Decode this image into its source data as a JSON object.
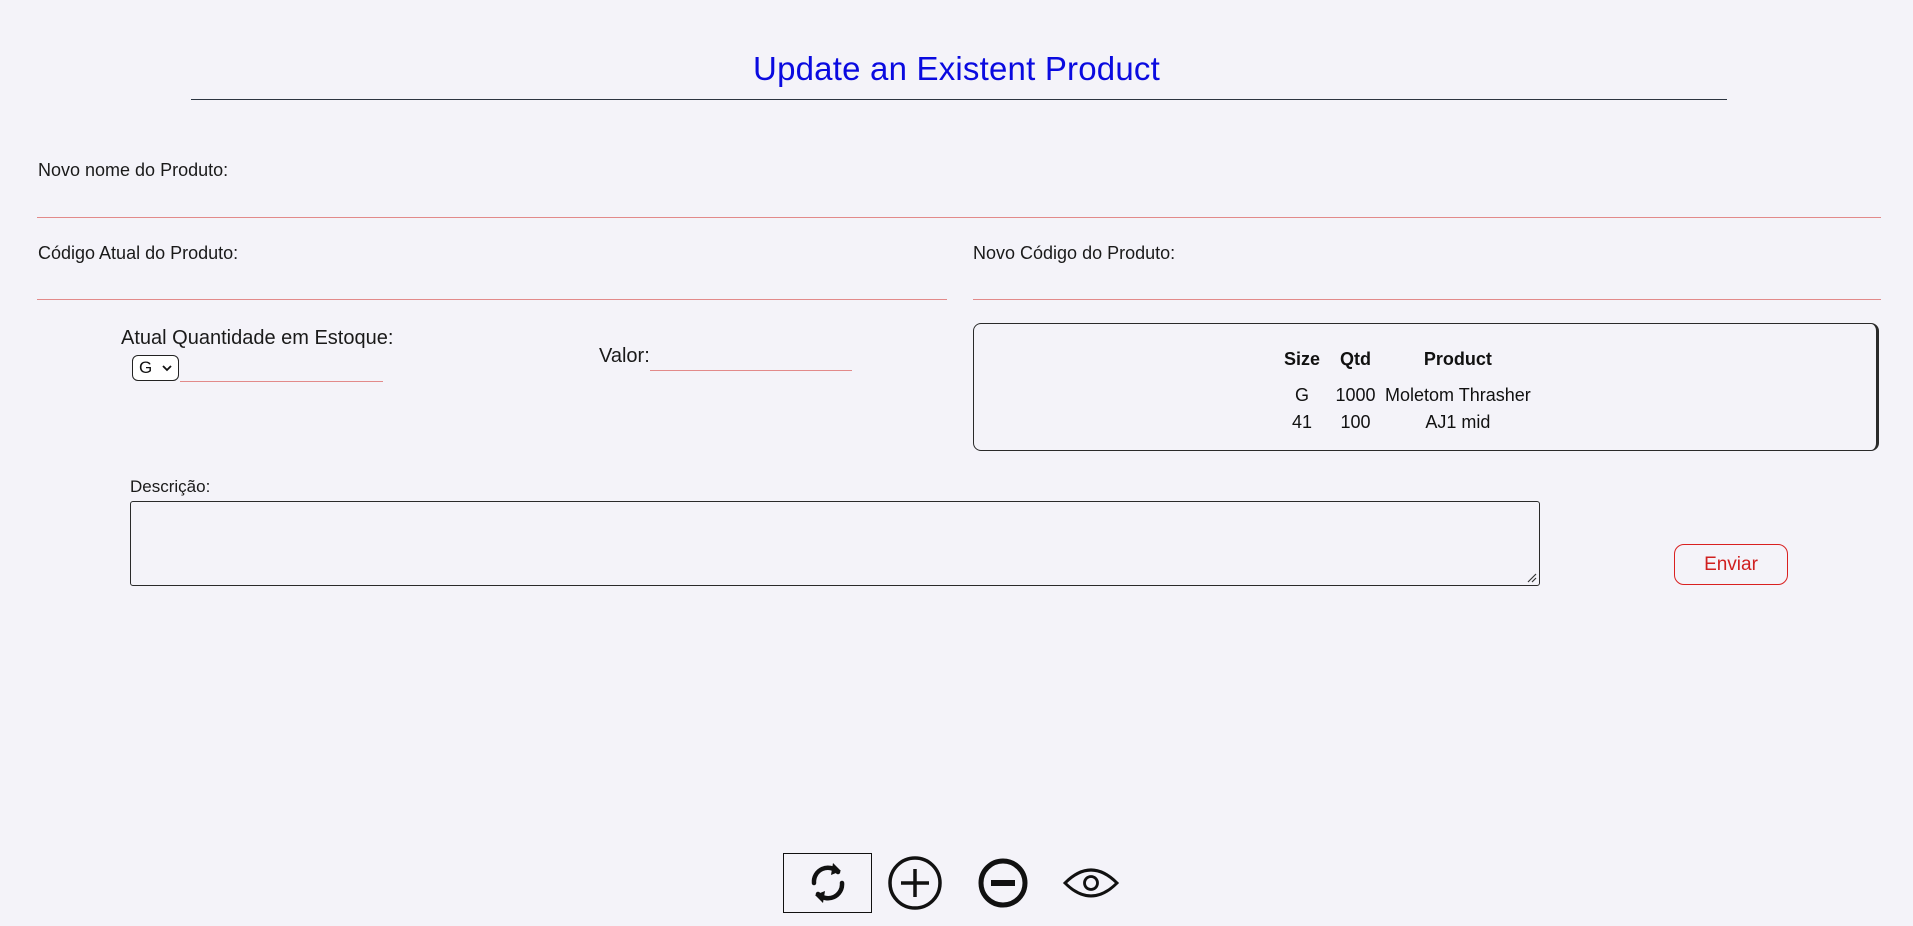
{
  "page": {
    "title": "Update an Existent Product"
  },
  "form": {
    "new_name_label": "Novo nome do Produto:",
    "current_code_label": "Código Atual do Produto:",
    "new_code_label": "Novo Código do Produto:",
    "stock_qty_label": "Atual Quantidade em Estoque:",
    "size_selected": "G",
    "value_label": "Valor:",
    "description_label": "Descrição:",
    "submit_label": "Enviar"
  },
  "stock_table": {
    "headers": [
      "Size",
      "Qtd",
      "Product"
    ],
    "rows": [
      [
        "G",
        "1000",
        "Moletom Thrasher"
      ],
      [
        "41",
        "100",
        "AJ1 mid"
      ]
    ]
  },
  "toolbar": {
    "icons": [
      "refresh-icon",
      "plus-circle-icon",
      "minus-circle-icon",
      "eye-icon"
    ]
  },
  "colors": {
    "title": "#0a0ae0",
    "accent_red": "#d92020",
    "underline": "#e28a8a",
    "background": "#f4f3f9"
  }
}
